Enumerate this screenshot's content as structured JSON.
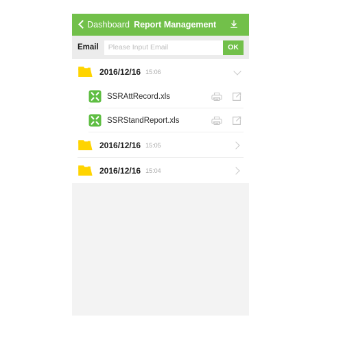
{
  "header": {
    "back_label": "Dashboard",
    "title": "Report Management",
    "back_icon": "chevron-left-icon",
    "download_icon": "download-icon",
    "bg_color": "#72c04a"
  },
  "email_bar": {
    "label": "Email",
    "placeholder": "Please Input Email",
    "value": "",
    "ok_label": "OK",
    "ok_color": "#72c04a"
  },
  "list": {
    "folder_icon": "folder-icon",
    "folder_color": "#ffd400",
    "file_icon": "xls-file-icon",
    "file_icon_color": "#5fbe43",
    "print_icon": "printer-icon",
    "share_icon": "share-export-icon",
    "groups": [
      {
        "date": "2016/12/16",
        "time": "15:06",
        "expanded": true,
        "chevron": "chevron-down-icon",
        "files": [
          {
            "name": "SSRAttRecord.xls"
          },
          {
            "name": "SSRStandReport.xls"
          }
        ]
      },
      {
        "date": "2016/12/16",
        "time": "15:05",
        "expanded": false,
        "chevron": "chevron-right-icon",
        "files": []
      },
      {
        "date": "2016/12/16",
        "time": "15:04",
        "expanded": false,
        "chevron": "chevron-right-icon",
        "files": []
      }
    ]
  }
}
